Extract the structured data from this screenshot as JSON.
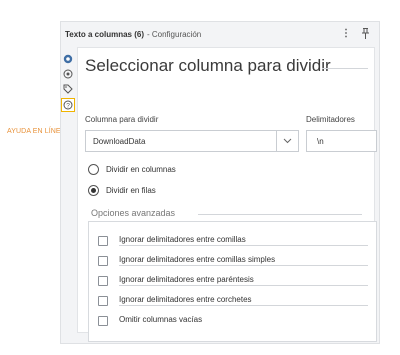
{
  "external_label": "AYUDA EN LÍNEA",
  "window": {
    "title": "Texto a columnas (6)",
    "subtitle": "- Configuración"
  },
  "rail": [
    {
      "name": "gear-icon"
    },
    {
      "name": "settings-icon"
    },
    {
      "name": "tag-icon"
    },
    {
      "name": "help-icon"
    }
  ],
  "panel": {
    "heading": "Seleccionar columna para dividir",
    "column_label": "Columna para dividir",
    "column_value": "DownloadData",
    "delimiters_label": "Delimitadores",
    "delimiters_value": "\\n",
    "radio_options": [
      {
        "label": "Dividir en columnas",
        "selected": false
      },
      {
        "label": "Dividir en filas",
        "selected": true
      }
    ],
    "advanced_title": "Opciones avanzadas",
    "advanced_options": [
      {
        "label": "Ignorar delimitadores entre comillas",
        "checked": false
      },
      {
        "label": "Ignorar delimitadores entre comillas simples",
        "checked": false
      },
      {
        "label": "Ignorar delimitadores entre paréntesis",
        "checked": false
      },
      {
        "label": "Ignorar delimitadores entre corchetes",
        "checked": false
      },
      {
        "label": "Omitir columnas vacías",
        "checked": false
      }
    ]
  },
  "colors": {
    "help_highlight": "#f0b400",
    "annotation": "#e8923a",
    "accent_blue": "#3f6ea5"
  }
}
